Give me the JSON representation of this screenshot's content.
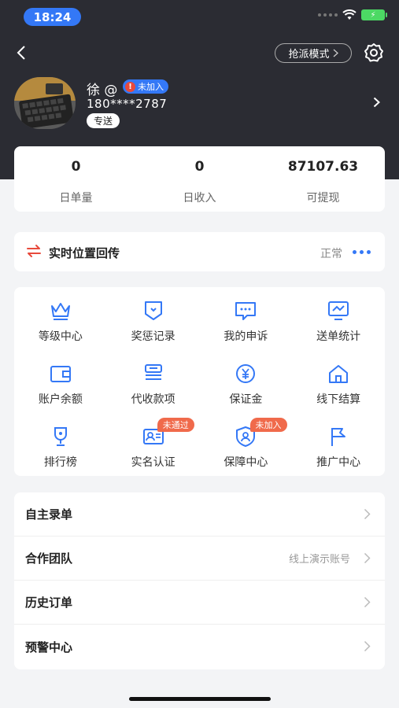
{
  "status_bar": {
    "time": "18:24"
  },
  "header": {
    "mode_button": "抢派模式",
    "user": {
      "name": "徐 @",
      "join_badge": "未加入",
      "phone": "180****2787",
      "tag": "专送"
    }
  },
  "stats": [
    {
      "value": "0",
      "label": "日单量"
    },
    {
      "value": "0",
      "label": "日收入"
    },
    {
      "value": "87107.63",
      "label": "可提现"
    }
  ],
  "location": {
    "title": "实时位置回传",
    "status": "正常"
  },
  "grid": [
    {
      "label": "等级中心",
      "icon": "crown-icon"
    },
    {
      "label": "奖惩记录",
      "icon": "shield-tag-icon"
    },
    {
      "label": "我的申诉",
      "icon": "chat-bubble-icon"
    },
    {
      "label": "送单统计",
      "icon": "chart-monitor-icon"
    },
    {
      "label": "账户余额",
      "icon": "wallet-icon"
    },
    {
      "label": "代收款项",
      "icon": "receipt-icon"
    },
    {
      "label": "保证金",
      "icon": "yen-coin-icon"
    },
    {
      "label": "线下结算",
      "icon": "house-icon"
    },
    {
      "label": "排行榜",
      "icon": "trophy-icon"
    },
    {
      "label": "实名认证",
      "icon": "id-card-icon",
      "badge": "未通过"
    },
    {
      "label": "保障中心",
      "icon": "shield-user-icon",
      "badge": "未加入"
    },
    {
      "label": "推广中心",
      "icon": "flag-icon"
    }
  ],
  "list": [
    {
      "label": "自主录单",
      "value": ""
    },
    {
      "label": "合作团队",
      "value": "线上演示账号"
    },
    {
      "label": "历史订单",
      "value": ""
    },
    {
      "label": "预警中心",
      "value": ""
    }
  ],
  "colors": {
    "header_bg": "#2b2c33",
    "accent": "#3478f6",
    "badge": "#f06a4b"
  }
}
